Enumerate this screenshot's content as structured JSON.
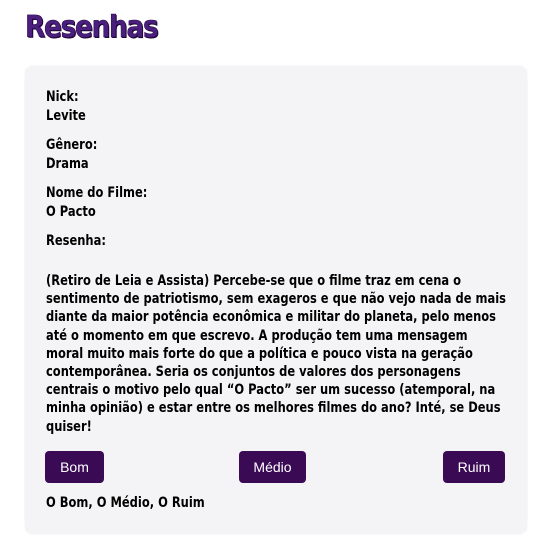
{
  "page": {
    "title": "Resenhas"
  },
  "review": {
    "nick_label": "Nick:",
    "nick_value": "Levite",
    "genre_label": "Gênero:",
    "genre_value": "Drama",
    "movie_label": "Nome do Filme:",
    "movie_value": "O Pacto",
    "review_label": "Resenha:",
    "review_lines": [
      "(Retiro de Leia e Assista) Percebe-se que o filme traz em cena o",
      "sentimento de patriotismo, sem exageros e que não vejo nada de mais",
      "diante da maior potência econômica e militar do planeta, pelo menos",
      "até o momento em que escrevo. A produção tem uma mensagem",
      "moral muito mais forte do que a política e pouco vista na geração",
      "contemporânea. Seria os conjuntos de valores dos personagens",
      "centrais o motivo pelo qual “O Pacto” ser um sucesso (atemporal, na",
      "minha opinião) e estar entre os melhores filmes do ano? Inté, se Deus",
      "quiser!"
    ]
  },
  "votes": {
    "good_label": "Bom",
    "medium_label": "Médio",
    "bad_label": "Ruim",
    "result_text": "O Bom, O Médio, O Ruim"
  },
  "colors": {
    "title": "#4b1f7e",
    "button": "#3b0a55",
    "card_background": "#f4f4f6"
  }
}
